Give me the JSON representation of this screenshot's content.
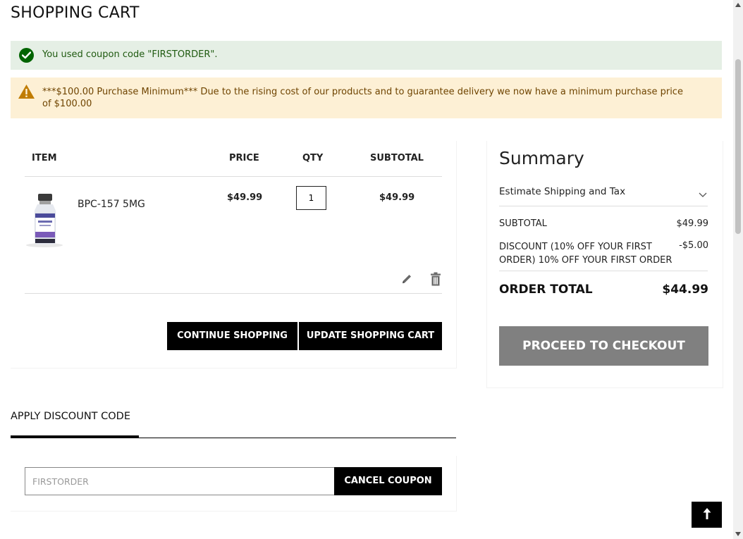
{
  "page": {
    "title": "SHOPPING CART"
  },
  "messages": {
    "success": "You used coupon code \"FIRSTORDER\".",
    "warning": "***$100.00 Purchase Minimum*** Due to the rising cost of our products and to guarantee delivery we now have a minimum purchase price of $100.00"
  },
  "cart": {
    "headers": {
      "item": "ITEM",
      "price": "PRICE",
      "qty": "QTY",
      "subtotal": "SUBTOTAL"
    },
    "items": [
      {
        "name": "BPC-157 5MG",
        "price": "$49.99",
        "qty": "1",
        "subtotal": "$49.99"
      }
    ],
    "continue_label": "CONTINUE SHOPPING",
    "update_label": "UPDATE SHOPPING CART"
  },
  "summary": {
    "title": "Summary",
    "estimate": "Estimate Shipping and Tax",
    "subtotal_label": "SUBTOTAL",
    "subtotal_value": "$49.99",
    "discount_label": "DISCOUNT (10% OFF YOUR FIRST ORDER) 10% OFF YOUR FIRST ORDER",
    "discount_value": "-$5.00",
    "total_label": "ORDER TOTAL",
    "total_value": "$44.99",
    "checkout_label": "PROCEED TO CHECKOUT"
  },
  "discount": {
    "title": "APPLY DISCOUNT CODE",
    "code": "FIRSTORDER",
    "cancel_label": "CANCEL COUPON"
  },
  "colors": {
    "success_bg": "#e5efe5",
    "warning_bg": "#fdf0d5",
    "checkout_bg": "#808080",
    "button_bg": "#000000"
  }
}
